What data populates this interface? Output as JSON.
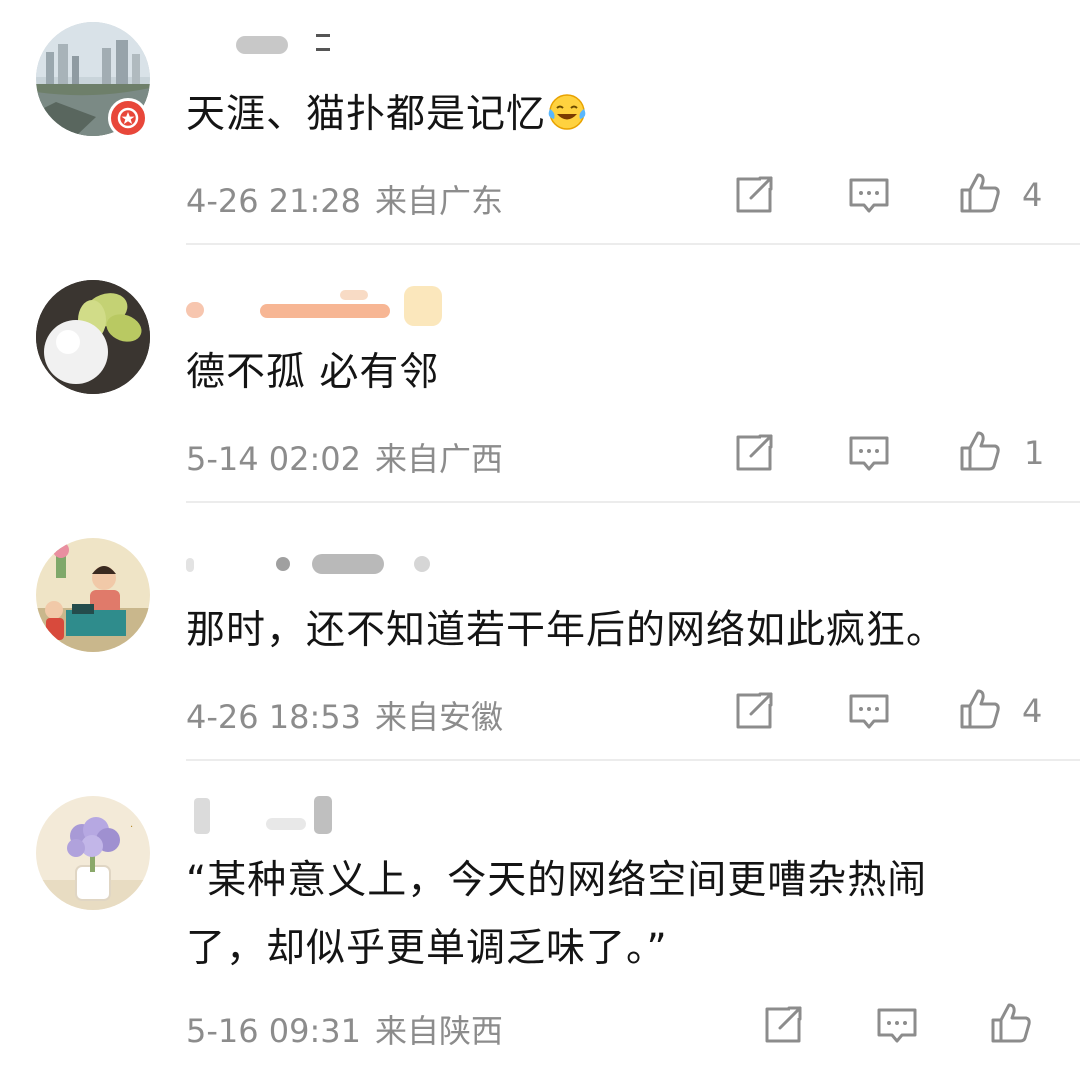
{
  "comments": [
    {
      "username": "",
      "text": "天涯、猫扑都是记忆",
      "emoji": "laughing-tears-emoji",
      "time": "4-26 21:28",
      "location": "来自广东",
      "likes": "4",
      "has_badge": true,
      "avatar": "city-river-avatar"
    },
    {
      "username": "",
      "text": "德不孤 必有邻",
      "time": "5-14 02:02",
      "location": "来自广西",
      "likes": "1",
      "avatar": "egg-avatar"
    },
    {
      "username": "",
      "text": "那时，还不知道若干年后的网络如此疯狂。",
      "time": "4-26 18:53",
      "location": "来自安徽",
      "likes": "4",
      "avatar": "vintage-poster-avatar"
    },
    {
      "username": "",
      "text_lines": [
        "“某种意义上，今天的网络空间更嘈杂热闹",
        "了，却似乎更单调乏味了。”"
      ],
      "time": "5-16 09:31",
      "location": "来自陕西",
      "likes": "",
      "avatar": "hydrangea-avatar"
    }
  ],
  "icons": {
    "repost": "repost-icon",
    "comment": "comment-icon",
    "like": "like-icon"
  },
  "colors": {
    "text": "#141414",
    "meta": "#8c8c8c",
    "divider": "#ececec",
    "badge": "#e8473a"
  }
}
